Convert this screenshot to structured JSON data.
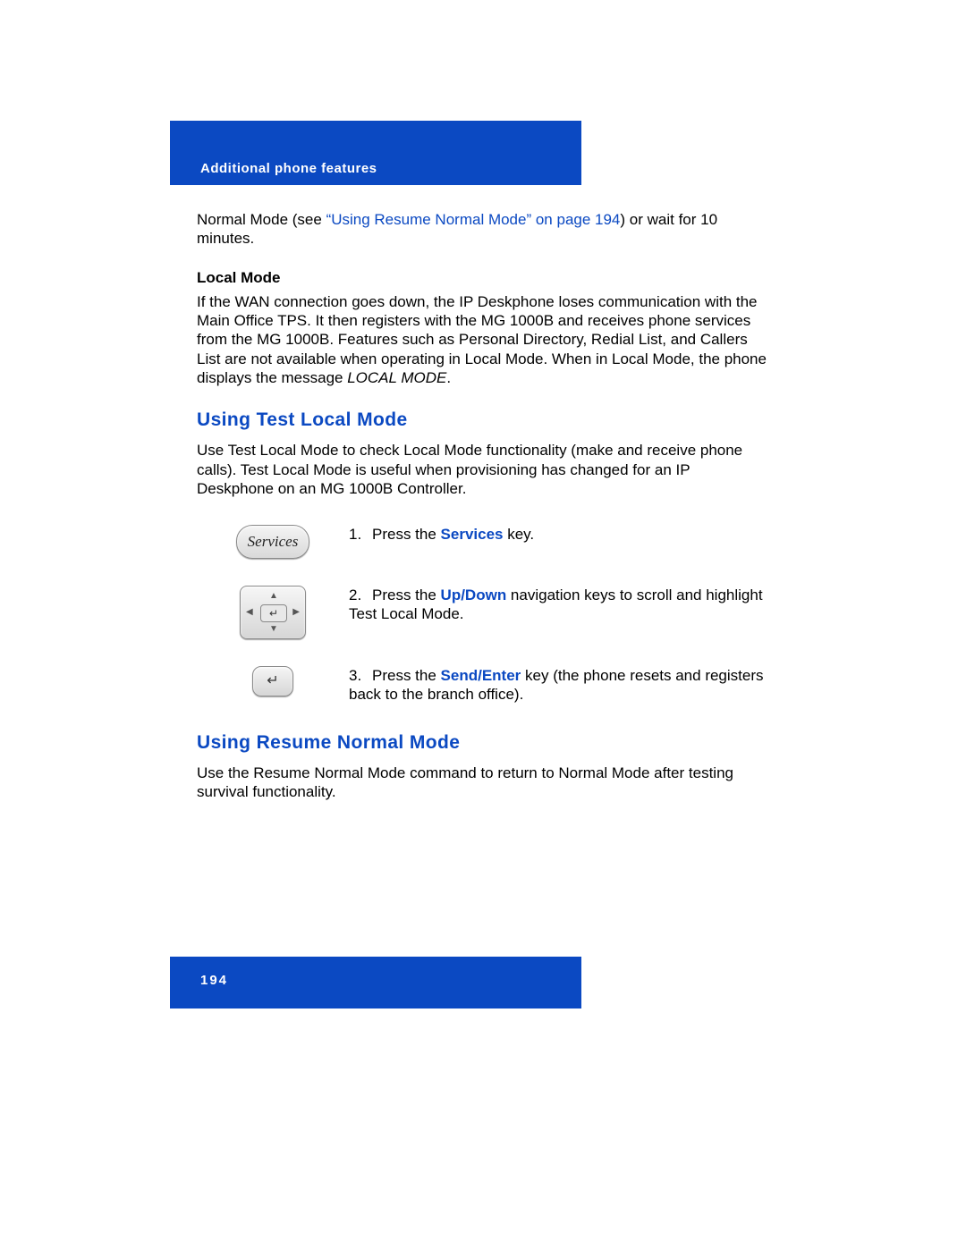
{
  "header": {
    "section": "Additional phone features"
  },
  "intro": {
    "pre": "Normal Mode (see ",
    "link": "“Using Resume Normal Mode” on page 194",
    "post": ") or wait for 10 minutes."
  },
  "localMode": {
    "title": "Local Mode",
    "body_pre": "If the WAN connection goes down, the IP Deskphone loses communication with the Main Office TPS. It then registers with the MG 1000B and receives phone services from the MG 1000B. Features such as Personal Directory, Redial List, and Callers List are not available when operating in Local Mode. When in Local Mode, the phone displays the message ",
    "body_em": "LOCAL MODE",
    "body_post": "."
  },
  "testLocal": {
    "title": "Using Test Local Mode",
    "body": "Use Test Local Mode to check Local Mode functionality (make and receive phone calls). Test Local Mode is useful when provisioning has changed for an IP Deskphone on an MG 1000B Controller.",
    "steps": [
      {
        "num": "1.",
        "pre": "Press the ",
        "key": "Services",
        "post": " key.",
        "icon": "services"
      },
      {
        "num": "2.",
        "pre": "Press the ",
        "key": "Up/Down",
        "post": " navigation keys to scroll and highlight Test Local Mode.",
        "icon": "navpad"
      },
      {
        "num": "3.",
        "pre": "Press the ",
        "key": "Send/Enter",
        "post": " key (the phone resets and registers back to the branch office).",
        "icon": "enter"
      }
    ]
  },
  "resumeNormal": {
    "title": "Using Resume Normal Mode",
    "body": "Use the Resume Normal Mode command to return to Normal Mode after testing survival functionality."
  },
  "footer": {
    "page": "194"
  },
  "icon_labels": {
    "services": "Services",
    "enter": "↵"
  }
}
